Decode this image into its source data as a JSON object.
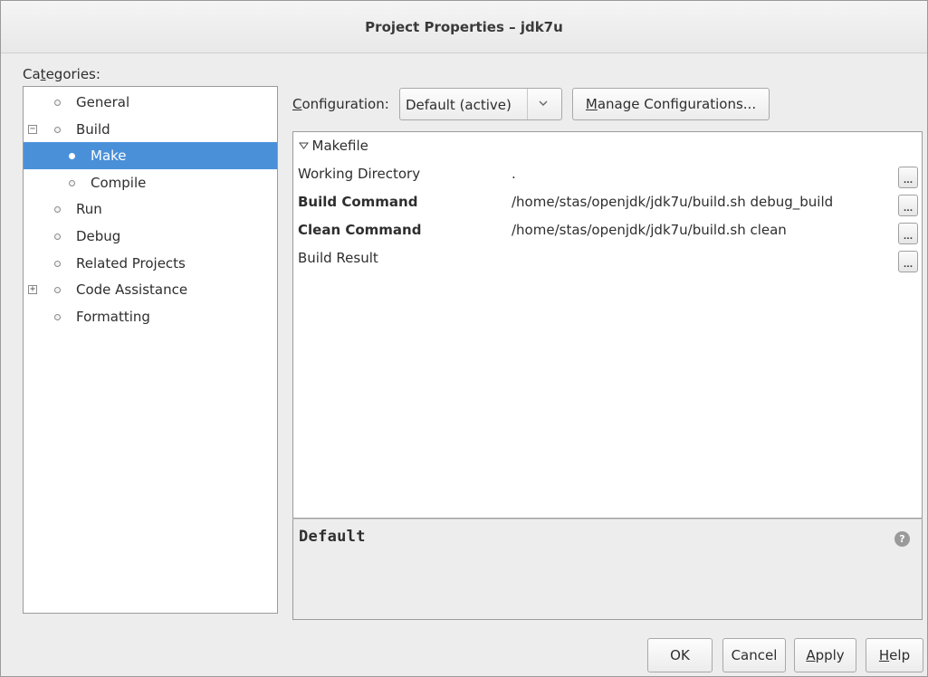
{
  "window": {
    "title": "Project Properties – jdk7u"
  },
  "categories": {
    "label_pre": "Ca",
    "label_mnemonic": "t",
    "label_post": "egories:",
    "items": [
      {
        "label": "General"
      },
      {
        "label": "Build",
        "expander": "−"
      },
      {
        "label": "Make"
      },
      {
        "label": "Compile"
      },
      {
        "label": "Run"
      },
      {
        "label": "Debug"
      },
      {
        "label": "Related Projects"
      },
      {
        "label": "Code Assistance",
        "expander": "+"
      },
      {
        "label": "Formatting"
      }
    ],
    "selected": "Make"
  },
  "configuration": {
    "label_mnemonic": "C",
    "label_rest": "onfiguration:",
    "selected_value": "Default (active)",
    "manage_mnemonic": "M",
    "manage_rest": "anage Configurations..."
  },
  "properties": {
    "section": "Makefile",
    "rows": [
      {
        "name": "Working Directory",
        "value": ".",
        "button": "..."
      },
      {
        "name": "Build Command",
        "value": "/home/stas/openjdk/jdk7u/build.sh debug_build",
        "button": "..."
      },
      {
        "name": "Clean Command",
        "value": "/home/stas/openjdk/jdk7u/build.sh clean",
        "button": "..."
      },
      {
        "name": "Build Result",
        "value": "",
        "button": "..."
      }
    ]
  },
  "description": {
    "title": "Default",
    "help_glyph": "?"
  },
  "buttons": {
    "ok": "OK",
    "cancel": "Cancel",
    "apply_mnemonic": "A",
    "apply_rest": "pply",
    "help_mnemonic": "H",
    "help_rest": "elp"
  }
}
